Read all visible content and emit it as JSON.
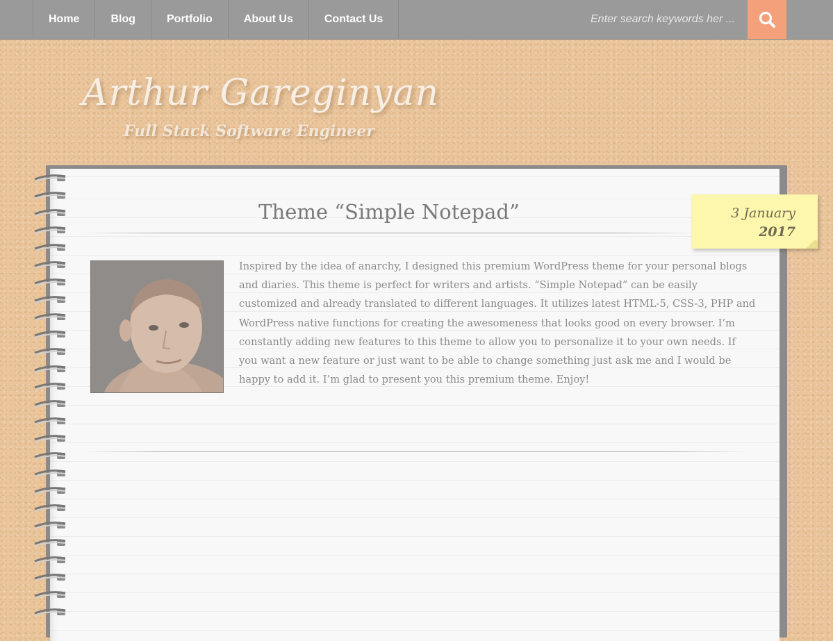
{
  "nav": {
    "items": [
      {
        "label": "Home"
      },
      {
        "label": "Blog"
      },
      {
        "label": "Portfolio"
      },
      {
        "label": "About Us"
      },
      {
        "label": "Contact Us"
      }
    ],
    "search": {
      "placeholder": "Enter search keywords her ...",
      "button_icon": "search-icon"
    }
  },
  "site": {
    "title": "Arthur Gareginyan",
    "tagline": "Full Stack Software Engineer"
  },
  "post": {
    "title": "Theme “Simple Notepad”",
    "date": {
      "day_month": "3 January",
      "year": "2017"
    },
    "body": "Inspired by the idea of anarchy, I designed this premium WordPress theme for your personal blogs and diaries. This theme is perfect for writers and artists. “Simple Notepad” can be easily customized and already translated to different languages. It utilizes latest HTML-5, CSS-3, PHP and WordPress native functions for creating the awesomeness that looks good on every browser. I’m constantly adding new features to this theme to allow you to personalize it to your own needs. If you want a new feature or just want to be able to change something just ask me and I would be happy to add it. I’m glad to present you this premium theme. Enjoy!",
    "image_icon": "portrait-photo"
  },
  "colors": {
    "nav_background": "#9a9a9a",
    "search_accent": "#f4a07b",
    "corkboard": "#eac59c",
    "sticky_note": "#fdf6ad",
    "page": "#f8f8f8"
  }
}
